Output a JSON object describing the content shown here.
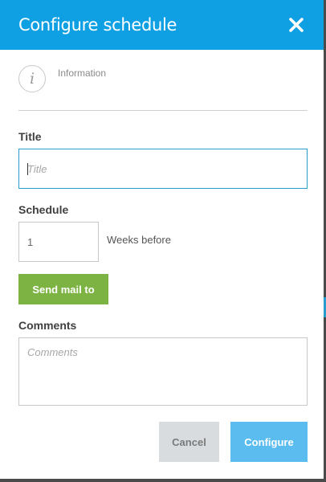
{
  "dialog": {
    "title": "Configure schedule",
    "close_icon": "close-icon",
    "info_icon_glyph": "i",
    "info_label": "Information"
  },
  "form": {
    "title_label": "Title",
    "title_placeholder": "Title",
    "title_value": "",
    "schedule_label": "Schedule",
    "weeks_value": "1",
    "weeks_suffix": "Weeks before",
    "send_mail_label": "Send mail to",
    "comments_label": "Comments",
    "comments_placeholder": "Comments",
    "comments_value": ""
  },
  "footer": {
    "cancel_label": "Cancel",
    "configure_label": "Configure"
  },
  "colors": {
    "header": "#0fa0e4",
    "send_button": "#7cb342",
    "configure_button": "#5bbcf0",
    "cancel_button": "#d8dcdf",
    "input_focus_border": "#2a9dcf"
  }
}
